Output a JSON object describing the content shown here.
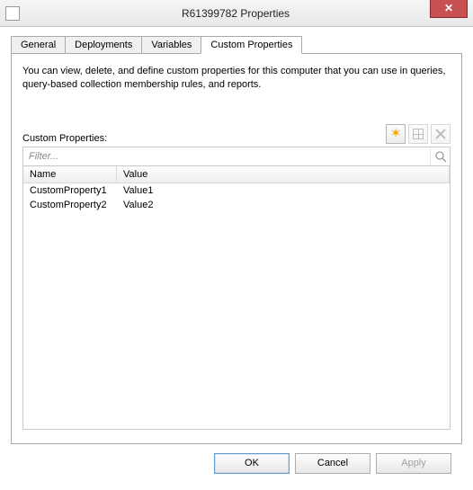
{
  "window": {
    "title": "R61399782 Properties"
  },
  "tabs": [
    {
      "label": "General"
    },
    {
      "label": "Deployments"
    },
    {
      "label": "Variables"
    },
    {
      "label": "Custom Properties"
    }
  ],
  "active_tab_index": 3,
  "panel": {
    "description": "You can view, delete, and define custom properties for this computer that you can use in queries, query-based collection membership rules, and reports.",
    "section_label": "Custom Properties:",
    "filter_placeholder": "Filter...",
    "columns": {
      "name": "Name",
      "value": "Value"
    },
    "rows": [
      {
        "name": "CustomProperty1",
        "value": "Value1"
      },
      {
        "name": "CustomProperty2",
        "value": "Value2"
      }
    ],
    "toolbar": {
      "new_enabled": true,
      "edit_enabled": false,
      "delete_enabled": false
    }
  },
  "buttons": {
    "ok": "OK",
    "cancel": "Cancel",
    "apply": "Apply",
    "apply_enabled": false
  }
}
